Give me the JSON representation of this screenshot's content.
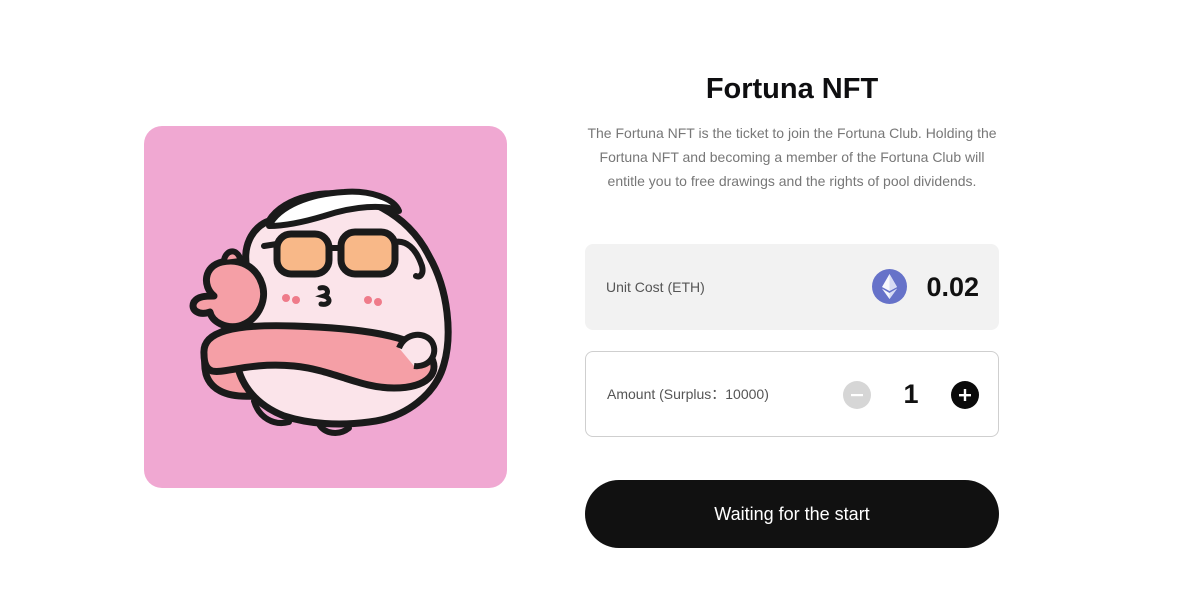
{
  "nft": {
    "title": "Fortuna NFT",
    "description": "The Fortuna NFT is the ticket to join the Fortuna Club. Holding the Fortuna NFT and becoming a member of the Fortuna Club will entitle you to free drawings and the rights of pool dividends.",
    "artwork_background": "#f0a8d2"
  },
  "cost": {
    "label": "Unit Cost (ETH)",
    "currency_icon": "ethereum-icon",
    "value": "0.02"
  },
  "amount": {
    "label": "Amount (Surplus：10000)",
    "quantity": "1",
    "decrement_icon": "minus-icon",
    "increment_icon": "plus-icon"
  },
  "action": {
    "button_label": "Waiting for the start"
  },
  "colors": {
    "accent_dark": "#111111",
    "ethereum_blue": "#6672c9",
    "card_pink": "#f0a8d2",
    "muted_text": "#777777"
  }
}
